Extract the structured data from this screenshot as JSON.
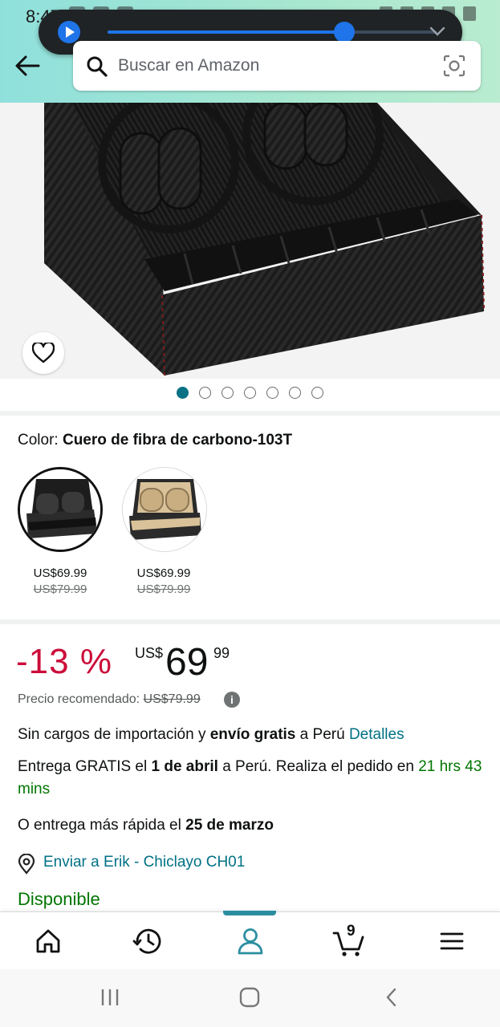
{
  "status_bar": {
    "time": "8:47"
  },
  "media": {
    "progress_percent": 72
  },
  "search": {
    "placeholder": "Buscar en Amazon"
  },
  "gallery": {
    "image_count": 7,
    "active_index": 0
  },
  "color": {
    "label": "Color: ",
    "selected_name": "Cuero de fibra de carbono-103T",
    "options": [
      {
        "price": "US$69.99",
        "old_price": "US$79.99",
        "finish": "black"
      },
      {
        "price": "US$69.99",
        "old_price": "US$79.99",
        "finish": "beige"
      }
    ]
  },
  "price": {
    "discount": "-13 %",
    "currency": "US$",
    "whole": "69",
    "fraction": "99",
    "recommended_label": "Precio recomendado:",
    "recommended_value": "US$79.99"
  },
  "shipping": {
    "import_prefix": "Sin cargos de importación y ",
    "import_bold": "envío gratis",
    "import_suffix": " a Perú ",
    "import_link": "Detalles",
    "delivery_prefix": "Entrega GRATIS el ",
    "delivery_date": "1 de abril",
    "delivery_suffix": " a Perú. Realiza el pedido en ",
    "delivery_countdown": "21 hrs 43 mins",
    "fast_prefix": "O entrega más rápida el ",
    "fast_date": "25 de marzo",
    "ship_to": "Enviar a Erik - Chiclayo CH01",
    "availability": "Disponible"
  },
  "bottom_nav": {
    "cart_count": "9"
  },
  "colors": {
    "teal": "#007185",
    "green": "#007600",
    "deal_red": "#cc0c39",
    "accent_bar": "#2b8ea0"
  }
}
